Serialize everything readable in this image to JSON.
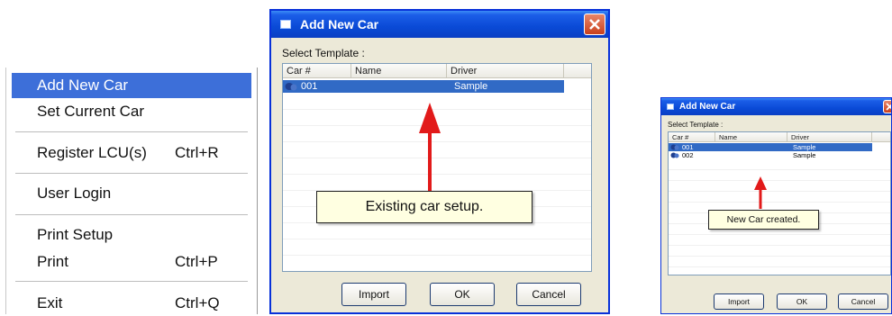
{
  "menu": {
    "items": [
      {
        "label": "Add New Car",
        "shortcut": ""
      },
      {
        "label": "Set Current Car",
        "shortcut": ""
      },
      {
        "label": "Register LCU(s)",
        "shortcut": "Ctrl+R"
      },
      {
        "label": "User Login",
        "shortcut": ""
      },
      {
        "label": "Print Setup",
        "shortcut": ""
      },
      {
        "label": "Print",
        "shortcut": "Ctrl+P"
      },
      {
        "label": "Exit",
        "shortcut": "Ctrl+Q"
      }
    ]
  },
  "dialog_before": {
    "title": "Add New Car",
    "template_label": "Select Template :",
    "columns": [
      "Car #",
      "Name",
      "Driver"
    ],
    "rows": [
      {
        "car": "001",
        "name": "",
        "driver": "Sample",
        "selected": true
      }
    ],
    "callout": "Existing car setup.",
    "buttons": {
      "import": "Import",
      "ok": "OK",
      "cancel": "Cancel"
    }
  },
  "dialog_after": {
    "title": "Add New Car",
    "template_label": "Select Template :",
    "columns": [
      "Car #",
      "Name",
      "Driver"
    ],
    "rows": [
      {
        "car": "001",
        "name": "",
        "driver": "Sample",
        "selected": true
      },
      {
        "car": "002",
        "name": "",
        "driver": "Sample",
        "selected": false
      }
    ],
    "callout": "New Car created.",
    "buttons": {
      "import": "Import",
      "ok": "OK",
      "cancel": "Cancel"
    }
  },
  "colors": {
    "titlebar": "#0a4ad6",
    "selection": "#316ac5",
    "menu_highlight": "#3d6fd9",
    "arrow": "#e21a1a",
    "callout_bg": "#ffffe1"
  }
}
